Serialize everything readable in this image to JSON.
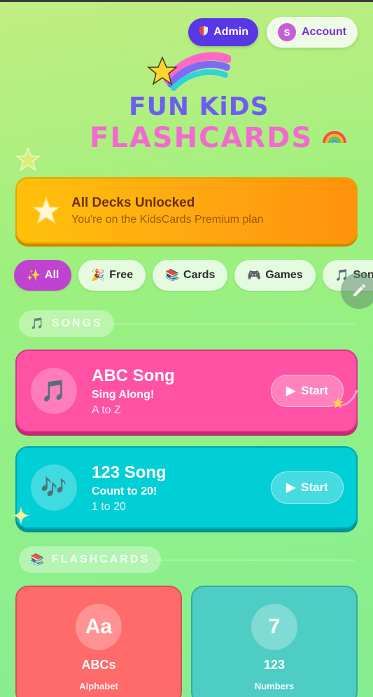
{
  "header": {
    "admin_label": "Admin",
    "account_label": "Account",
    "account_initial": "S"
  },
  "logo": {
    "line1": "FUN KiDS",
    "line2": "FLASHCARDS"
  },
  "premium_banner": {
    "title": "All Decks Unlocked",
    "subtitle": "You're on the KidsCards Premium plan"
  },
  "filters": [
    {
      "emoji": "✨",
      "label": "All",
      "active": true
    },
    {
      "emoji": "🎉",
      "label": "Free",
      "active": false
    },
    {
      "emoji": "📚",
      "label": "Cards",
      "active": false
    },
    {
      "emoji": "🎮",
      "label": "Games",
      "active": false
    },
    {
      "emoji": "🎵",
      "label": "Songs",
      "active": false
    }
  ],
  "sections": {
    "songs": {
      "emoji": "🎵",
      "label": "SONGS"
    },
    "flashcards": {
      "emoji": "📚",
      "label": "FLASHCARDS"
    }
  },
  "songs": [
    {
      "icon": "music-note-icon",
      "glyph": "🎵",
      "title": "ABC Song",
      "subtitle": "Sing Along!",
      "meta": "A to Z",
      "start_label": "Start",
      "color": "#ff52a5"
    },
    {
      "icon": "music-notes-icon",
      "glyph": "🎶",
      "title": "123 Song",
      "subtitle": "Count to 20!",
      "meta": "1 to 20",
      "start_label": "Start",
      "color": "#00cfd6"
    }
  ],
  "flashcards": [
    {
      "badge": "Aa",
      "title": "ABCs",
      "subtitle": "Alphabet",
      "color": "#ff6a6a"
    },
    {
      "badge": "7",
      "title": "123",
      "subtitle": "Numbers",
      "color": "#4ecdc4"
    }
  ],
  "colors": {
    "accent": "#5a37e6",
    "account_text": "#7c2bd6",
    "premium": "#ffa912",
    "filter_active": "#c042d0"
  }
}
